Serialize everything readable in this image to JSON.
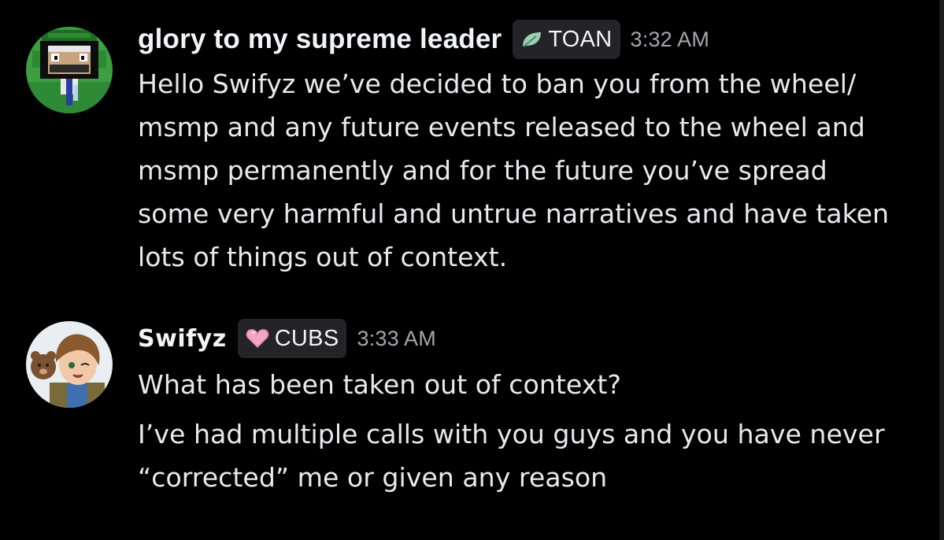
{
  "messages": [
    {
      "author": "glory to my supreme leader",
      "tag": {
        "label": "TOAN",
        "icon": "leaf-icon",
        "color": "#9ad0b4"
      },
      "timestamp": "3:32 AM",
      "avatar": "green-cap-character-avatar",
      "lines": [
        "Hello Swifyz we’ve decided to ban you from the wheel/",
        "msmp and any future events released to the wheel and",
        "msmp permanently and for the future you’ve spread",
        "some very harmful and untrue narratives and have taken",
        "lots of things out of context."
      ]
    },
    {
      "author": "Swifyz",
      "tag": {
        "label": "CUBS",
        "icon": "heart-icon",
        "color": "#f1a7c1"
      },
      "timestamp": "3:33 AM",
      "avatar": "brown-hair-character-with-teddy-bear-avatar",
      "paragraphs": [
        [
          "What has been taken out of context?"
        ],
        [
          "I’ve had multiple calls with you guys and you have never",
          "“corrected” me or given any reason"
        ]
      ]
    }
  ]
}
